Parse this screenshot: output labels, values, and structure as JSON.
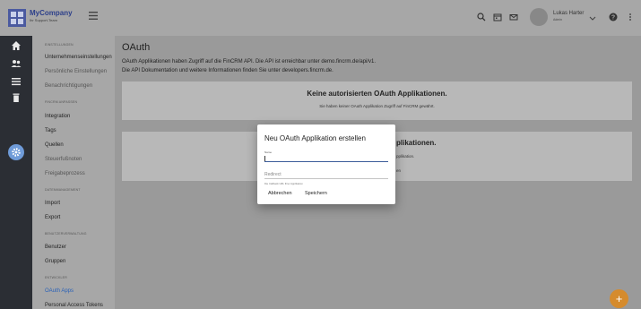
{
  "brand": {
    "name": "MyCompany",
    "tagline": "Ihr Support-Team",
    "color": "#2c3f8a"
  },
  "topbar": {
    "icons": [
      "search-icon",
      "calendar-icon",
      "mail-icon",
      "help-icon",
      "more-vert-icon"
    ],
    "user": {
      "name": "Lukas Harter",
      "subtitle": "Admin"
    }
  },
  "rail": {
    "icons": [
      "home-icon",
      "people-icon",
      "list-icon",
      "delete-icon",
      "settings-icon"
    ],
    "active": "settings-icon",
    "active_color": "#6f9bd8"
  },
  "sidebar": {
    "sections": [
      {
        "title": "EINSTELLUNGEN",
        "items": [
          {
            "label": "Unternehmenseinstellungen",
            "state": "normal"
          },
          {
            "label": "Persönliche Einstellungen",
            "state": "muted"
          },
          {
            "label": "Benachrichtigungen",
            "state": "muted"
          }
        ]
      },
      {
        "title": "FINCRM ANPASSEN",
        "items": [
          {
            "label": "Integration",
            "state": "normal"
          },
          {
            "label": "Tags",
            "state": "normal"
          },
          {
            "label": "Quellen",
            "state": "normal"
          },
          {
            "label": "Steuerfußnoten",
            "state": "muted"
          },
          {
            "label": "Freigabeprozess",
            "state": "muted"
          }
        ]
      },
      {
        "title": "DATENMANAGEMENT",
        "items": [
          {
            "label": "Import",
            "state": "normal"
          },
          {
            "label": "Export",
            "state": "normal"
          }
        ]
      },
      {
        "title": "BENUTZERVERWALTUNG",
        "items": [
          {
            "label": "Benutzer",
            "state": "normal"
          },
          {
            "label": "Gruppen",
            "state": "normal"
          }
        ]
      },
      {
        "title": "ENTWICKLER",
        "items": [
          {
            "label": "OAuth Apps",
            "state": "active"
          },
          {
            "label": "Personal Access Tokens",
            "state": "normal"
          }
        ]
      }
    ]
  },
  "main": {
    "title": "OAuth",
    "intro_line1": "OAuth Applikationen haben Zugriff auf die FinCRM API. Die API ist erreichbar unter demo.fincrm.de/api/v1.",
    "intro_line2": "Die API Dokumentation und weitere Informationen finden Sie unter developers.fincrm.de.",
    "card1": {
      "title": "Keine autorisierten OAuth Applikationen.",
      "subtitle": "Sie haben keiner OAuth Applikation Zugriff auf FinCRM gewährt."
    },
    "card2": {
      "title": "plikationen.",
      "subtitle1": "pplikation.",
      "subtitle2": "en"
    }
  },
  "dialog": {
    "title": "Neu OAuth Applikation erstellen",
    "name_label": "Name",
    "name_value": "",
    "redirect_placeholder": "Redirect",
    "redirect_hint": "Die Callback URL Ihrer Applikation",
    "cancel_label": "Abbrechen",
    "save_label": "Speichern"
  },
  "fab": {
    "label": "+",
    "color": "#d58b2d"
  }
}
